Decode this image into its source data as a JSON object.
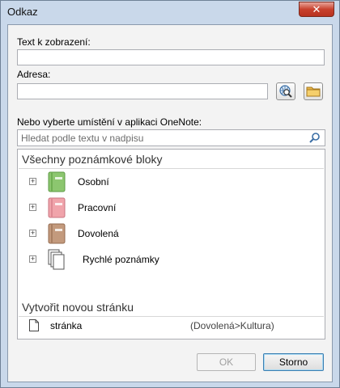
{
  "window": {
    "title": "Odkaz",
    "close_glyph": "✕"
  },
  "form": {
    "display_text_label": "Text k zobrazení:",
    "display_text_value": "",
    "address_label": "Adresa:",
    "address_value": "",
    "browse_web_icon": "globe-search-icon",
    "browse_file_icon": "folder-icon",
    "location_label": "Nebo vyberte umístění v aplikaci OneNote:"
  },
  "search": {
    "placeholder": "Hledat podle textu v nadpisu",
    "icon": "magnifier-icon"
  },
  "notebooks": {
    "header": "Všechny poznámkové bloky",
    "items": [
      {
        "label": "Osobní",
        "color": "#8cc66f",
        "expander": "+"
      },
      {
        "label": "Pracovní",
        "color": "#f0a4ab",
        "expander": "+"
      },
      {
        "label": "Dovolená",
        "color": "#c39a7d",
        "expander": "+"
      },
      {
        "label": "Rychlé poznámky",
        "color": "#ffffff",
        "expander": "+"
      }
    ]
  },
  "new_page": {
    "header": "Vytvořit novou stránku",
    "page_title": "stránka",
    "page_path": "(Dovolená>Kultura)"
  },
  "buttons": {
    "ok": "OK",
    "cancel": "Storno"
  }
}
